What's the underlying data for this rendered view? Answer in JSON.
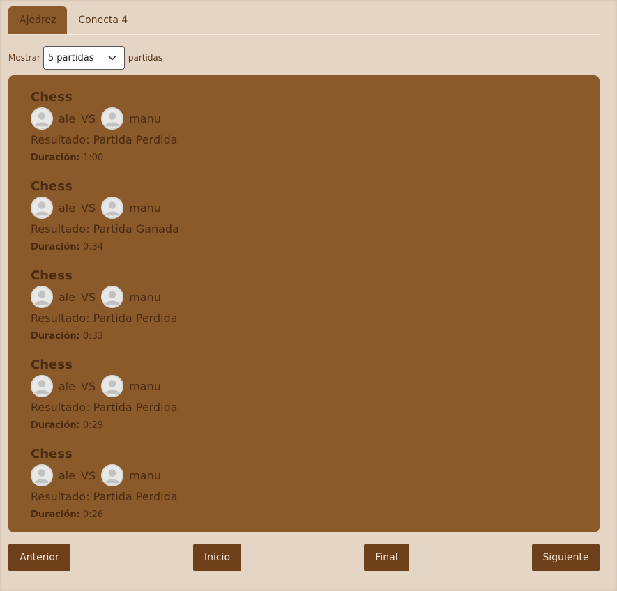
{
  "tabs": [
    {
      "label": "Ajedrez",
      "active": true
    },
    {
      "label": "Conecta 4",
      "active": false
    }
  ],
  "filter": {
    "prefix": "Mostrar",
    "selected": "5 partidas",
    "suffix": "partidas"
  },
  "games": [
    {
      "title": "Chess",
      "player1": "ale",
      "vs": "VS",
      "player2": "manu",
      "result": "Resultado: Partida Perdida",
      "duration_label": "Duración:",
      "duration": "1:00"
    },
    {
      "title": "Chess",
      "player1": "ale",
      "vs": "VS",
      "player2": "manu",
      "result": "Resultado: Partida Ganada",
      "duration_label": "Duración:",
      "duration": "0:34"
    },
    {
      "title": "Chess",
      "player1": "ale",
      "vs": "VS",
      "player2": "manu",
      "result": "Resultado: Partida Perdida",
      "duration_label": "Duración:",
      "duration": "0:33"
    },
    {
      "title": "Chess",
      "player1": "ale",
      "vs": "VS",
      "player2": "manu",
      "result": "Resultado: Partida Perdida",
      "duration_label": "Duración:",
      "duration": "0:29"
    },
    {
      "title": "Chess",
      "player1": "ale",
      "vs": "VS",
      "player2": "manu",
      "result": "Resultado: Partida Perdida",
      "duration_label": "Duración:",
      "duration": "0:26"
    }
  ],
  "pagination": {
    "prev": "Anterior",
    "first": "Inicio",
    "last": "Final",
    "next": "Siguiente"
  },
  "icons": {
    "avatar": "user-avatar-icon",
    "select": "chevron-down-icon"
  },
  "colors": {
    "background": "#e5d5c4",
    "panel": "#8b5a2b",
    "button": "#6e4019",
    "text": "#4a2a10"
  }
}
